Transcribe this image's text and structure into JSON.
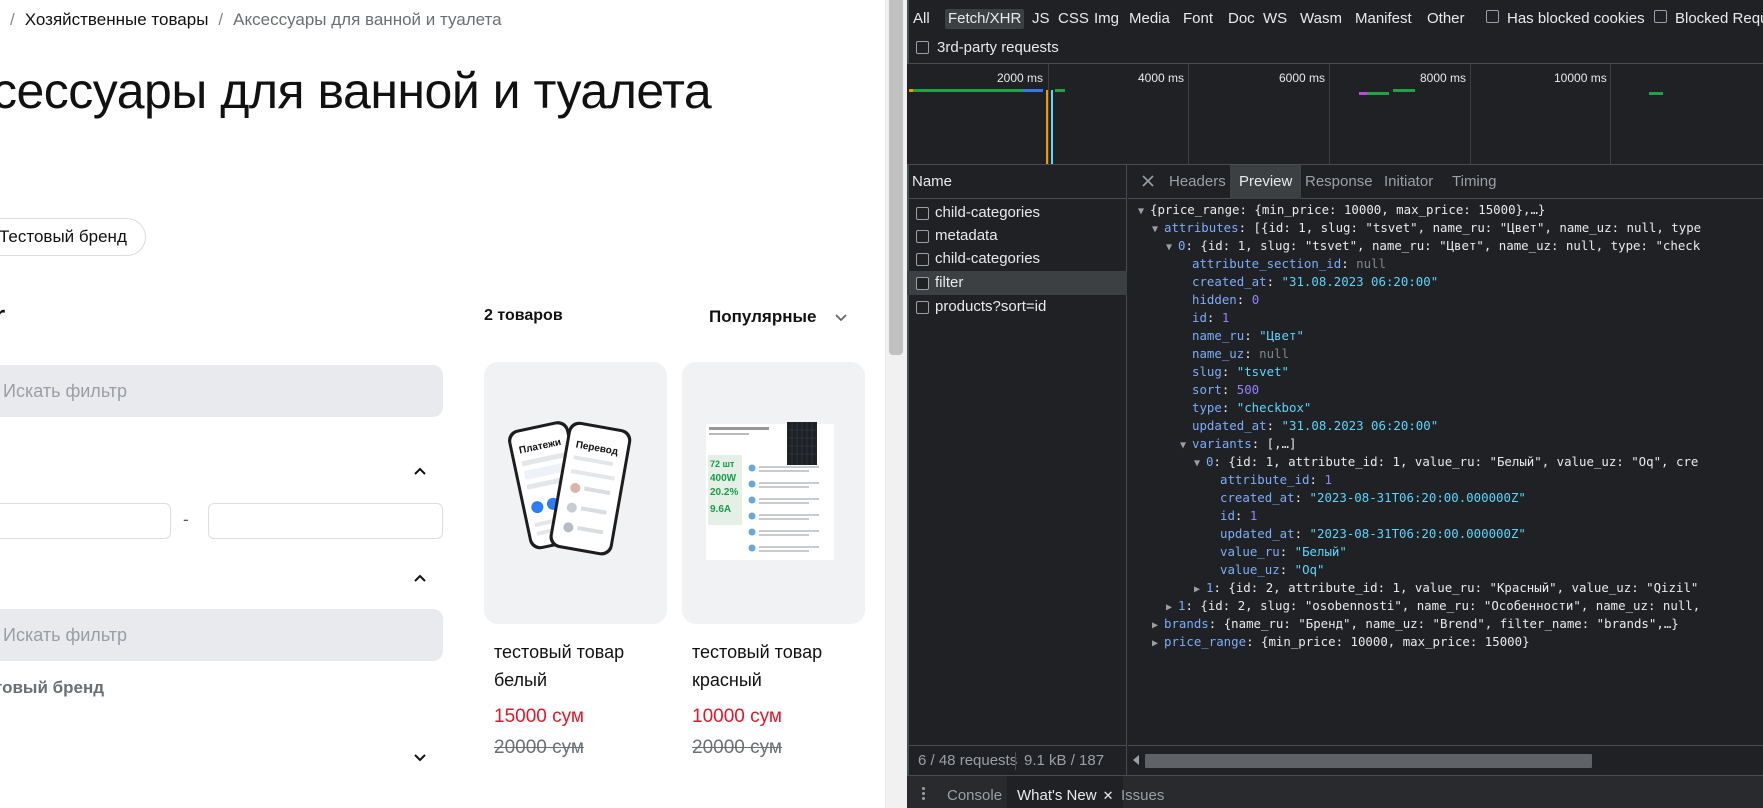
{
  "site": {
    "breadcrumb": {
      "sep1": "/",
      "item1": "Хозяйственные товары",
      "sep2": "/",
      "item2": "Аксессуары для ванной и туалета"
    },
    "title": "сессуары для ванной и туалета",
    "brand_chip": "Тестовый бренд",
    "filters_heading": "r",
    "filter_search_placeholder": "Искать фильтр",
    "price_dash": "-",
    "brand_option": "товый бренд",
    "products_count": "2 товаров",
    "sort_label": "Популярные",
    "products": [
      {
        "name": "тестовый товар белый",
        "price": "15000 сум",
        "old_price": "20000 сум",
        "image": "phone-payments-app"
      },
      {
        "name": "тестовый товар красный",
        "price": "10000 сум",
        "old_price": "20000 сум",
        "image": "solar-panel-specs"
      }
    ],
    "card2_stats": [
      "72 шт",
      "400W",
      "20.2%",
      "9.6A"
    ],
    "phone_screen_left": "Платежи",
    "phone_screen_right": "Перевод",
    "colors": {
      "price": "#e3172c",
      "muted": "#6b6f75",
      "search_bg": "#e9eaed"
    }
  },
  "devtools": {
    "filter_types": [
      "All",
      "Fetch/XHR",
      "JS",
      "CSS",
      "Img",
      "Media",
      "Font",
      "Doc",
      "WS",
      "Wasm",
      "Manifest",
      "Other"
    ],
    "active_filter": "Fetch/XHR",
    "checkboxes": {
      "blocked_cookies": "Has blocked cookies",
      "blocked_requests": "Blocked Requ",
      "third_party": "3rd-party requests"
    },
    "overview_ticks": [
      "2000 ms",
      "4000 ms",
      "6000 ms",
      "8000 ms",
      "10000 ms"
    ],
    "name_header": "Name",
    "requests": [
      "child-categories",
      "metadata",
      "child-categories",
      "metadata",
      "filter",
      "products?sort=id"
    ],
    "selected_request": "filter",
    "status": {
      "requests": "6 / 48 requests",
      "transferred": "9.1 kB / 187"
    },
    "tabs": [
      "Headers",
      "Preview",
      "Response",
      "Initiator",
      "Timing"
    ],
    "active_tab": "Preview",
    "drawer_tabs": [
      "Console",
      "What's New",
      "Issues"
    ],
    "drawer_active": "What's New",
    "json_preview": {
      "l0": "{price_range: {min_price: 10000, max_price: 15000},…}",
      "l1": "[{id: 1, slug: \"tsvet\", name_ru: \"Цвет\", name_uz: null, type",
      "l2": "{id: 1, slug: \"tsvet\", name_ru: \"Цвет\", name_uz: null, type: \"check",
      "attribute_section_id": "null",
      "created_at": "\"31.08.2023 06:20:00\"",
      "hidden": "0",
      "id": "1",
      "name_ru": "\"Цвет\"",
      "name_uz": "null",
      "slug": "\"tsvet\"",
      "sort": "500",
      "type": "\"checkbox\"",
      "updated_at": "\"31.08.2023 06:20:00\"",
      "variants": "[,…]",
      "v0": "{id: 1, attribute_id: 1, value_ru: \"Белый\", value_uz: \"Oq\", cre",
      "v_attribute_id": "1",
      "v_created_at": "\"2023-08-31T06:20:00.000000Z\"",
      "v_id": "1",
      "v_updated_at": "\"2023-08-31T06:20:00.000000Z\"",
      "v_value_ru": "\"Белый\"",
      "v_value_uz": "\"Oq\"",
      "v1": "{id: 2, attribute_id: 1, value_ru: \"Красный\", value_uz: \"Qizil\"",
      "a1": "{id: 2, slug: \"osobennosti\", name_ru: \"Особенности\", name_uz: null,",
      "brands": "{name_ru: \"Бренд\", name_uz: \"Brend\", filter_name: \"brands\",…}",
      "price_range": "{min_price: 10000, max_price: 15000}"
    }
  }
}
